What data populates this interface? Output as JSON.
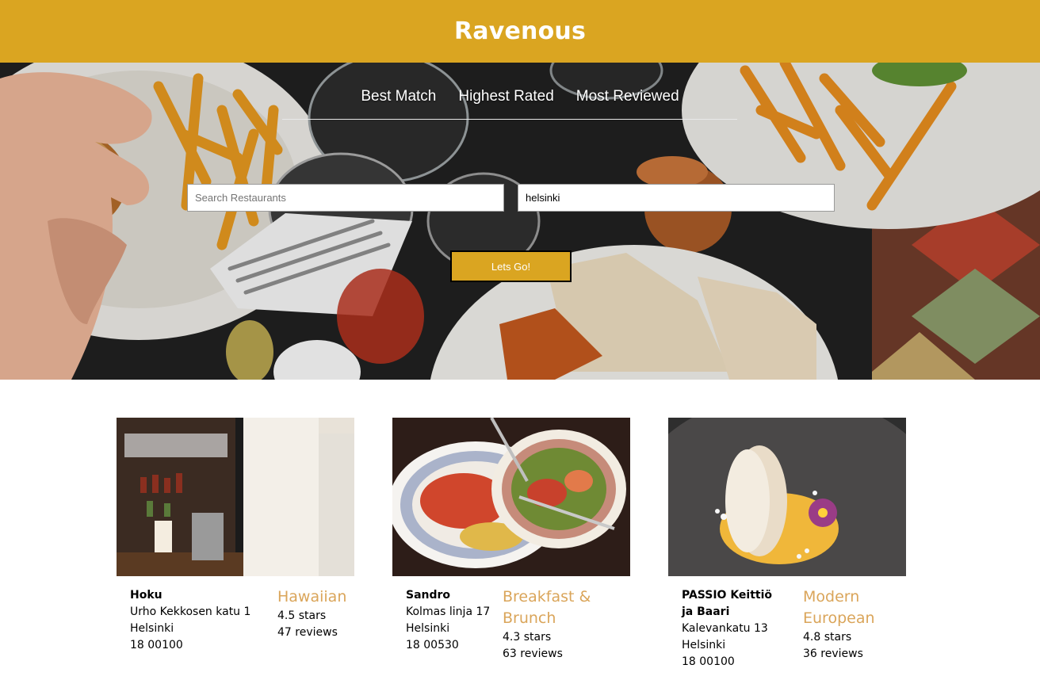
{
  "app": {
    "title": "Ravenous"
  },
  "colors": {
    "brand": "#daa521",
    "category": "#daa55a"
  },
  "sort_options": [
    {
      "label": "Best Match"
    },
    {
      "label": "Highest Rated"
    },
    {
      "label": "Most Reviewed"
    }
  ],
  "search": {
    "term_placeholder": "Search Restaurants",
    "term_value": "",
    "location_value": "helsinki",
    "submit_label": "Lets Go!"
  },
  "businesses": [
    {
      "name": "Hoku",
      "address": "Urho Kekkosen katu 1",
      "city": "Helsinki",
      "zip": "18 00100",
      "category": "Hawaiian",
      "rating": "4.5 stars",
      "review_count": "47 reviews",
      "image_icon": "bar-interior-photo"
    },
    {
      "name": "Sandro",
      "address": "Kolmas linja 17",
      "city": "Helsinki",
      "zip": "18 00530",
      "category": "Breakfast & Brunch",
      "rating": "4.3 stars",
      "review_count": "63 reviews",
      "image_icon": "brunch-plates-photo"
    },
    {
      "name": "PASSIO Keittiö ja Baari",
      "address": "Kalevankatu 13",
      "city": "Helsinki",
      "zip": "18 00100",
      "category": "Modern European",
      "rating": "4.8 stars",
      "review_count": "36 reviews",
      "image_icon": "dessert-plate-photo"
    }
  ]
}
